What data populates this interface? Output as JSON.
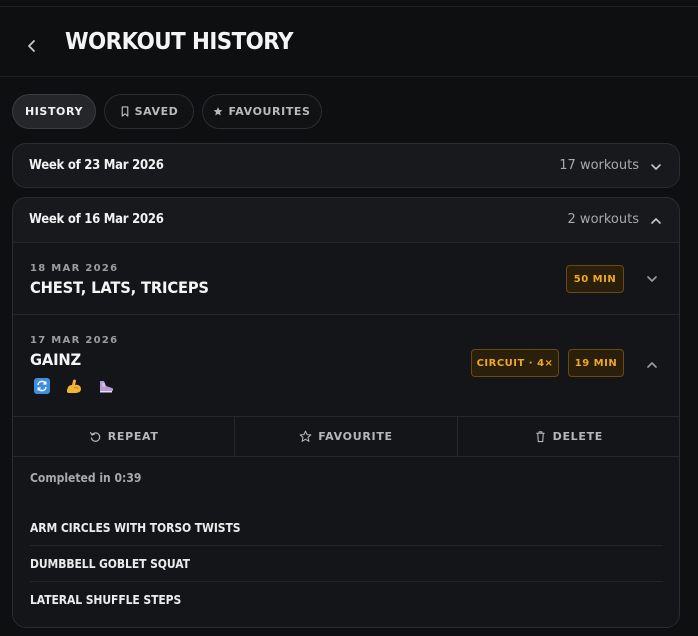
{
  "header": {
    "title": "WORKOUT HISTORY"
  },
  "tabs": [
    {
      "label": "HISTORY",
      "active": true
    },
    {
      "label": "SAVED",
      "icon": "bookmark-icon"
    },
    {
      "label": "FAVOURITES",
      "icon": "star-icon"
    }
  ],
  "weeks": [
    {
      "label": "Week of 23 Mar 2026",
      "count": "17 workouts",
      "expanded": false
    },
    {
      "label": "Week of 16 Mar 2026",
      "count": "2 workouts",
      "expanded": true,
      "workouts": [
        {
          "date": "18 MAR 2026",
          "name": "CHEST, LATS, TRICEPS",
          "duration": "50 MIN"
        },
        {
          "date": "17 MAR 2026",
          "name": "GAINZ",
          "circuit": "CIRCUIT · 4×",
          "duration": "19 MIN",
          "emojis": [
            "repeat-emoji-icon",
            "flexed-biceps-emoji-icon",
            "sneaker-emoji-icon"
          ],
          "actions": {
            "repeat": "REPEAT",
            "favourite": "FAVOURITE",
            "delete": "DELETE"
          },
          "completed": "Completed in 0:39",
          "exercises": [
            "ARM CIRCLES WITH TORSO TWISTS",
            "DUMBBELL GOBLET SQUAT",
            "LATERAL SHUFFLE STEPS"
          ]
        }
      ]
    }
  ],
  "colors": {
    "accent": "#f1a825",
    "background": "#0e0f11",
    "card": "#18191c"
  }
}
